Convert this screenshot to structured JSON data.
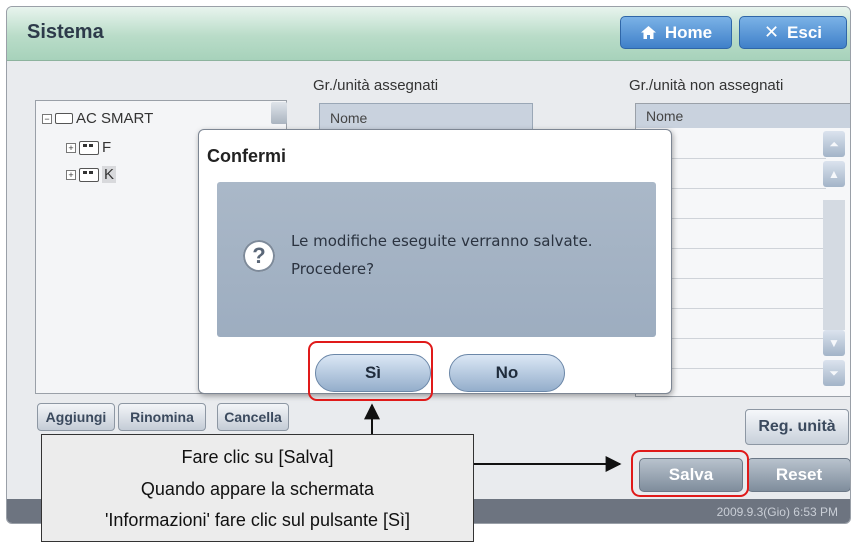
{
  "header": {
    "title": "Sistema",
    "home_label": "Home",
    "exit_label": "Esci"
  },
  "columns": {
    "assigned_title": "Gr./unità assegnati",
    "unassigned_title": "Gr./unità non assegnati",
    "name_header": "Nome"
  },
  "tree": {
    "root": "AC SMART",
    "items": [
      "F",
      "K"
    ]
  },
  "tree_buttons": {
    "add": "Aggiungi",
    "rename": "Rinomina",
    "delete": "Cancella"
  },
  "actions": {
    "reg_units": "Reg. unità",
    "save": "Salva",
    "reset": "Reset"
  },
  "status": {
    "clock": "2009.9.3(Gio) 6:53 PM"
  },
  "dialog": {
    "title": "Confermi",
    "message_line1": "Le modifiche eseguite verranno salvate.",
    "message_line2": "Procedere?",
    "yes_label": "Sì",
    "no_label": "No"
  },
  "callout": {
    "line1": "Fare clic su [Salva]",
    "line2": "Quando appare la schermata",
    "line3": "'Informazioni' fare clic sul pulsante [Sì]"
  },
  "colors": {
    "highlight": "#e01a1a",
    "title_bar": "#b9dcc8",
    "accent_button": "#3f80c9"
  },
  "icons": [
    "home-icon",
    "close-icon",
    "question-icon",
    "expand-icon",
    "scroll-up-icon",
    "scroll-down-icon"
  ]
}
